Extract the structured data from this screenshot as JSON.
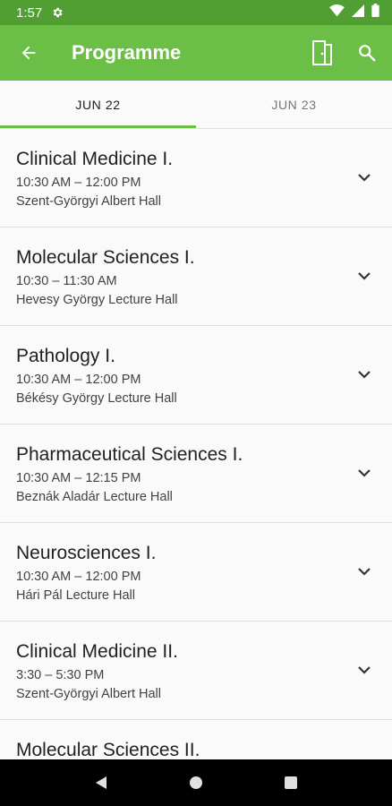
{
  "status_bar": {
    "time": "1:57"
  },
  "app_bar": {
    "title": "Programme"
  },
  "tabs": [
    {
      "label": "JUN 22",
      "active": true
    },
    {
      "label": "JUN 23",
      "active": false
    }
  ],
  "sessions": [
    {
      "title": "Clinical Medicine I.",
      "time": "10:30 AM – 12:00 PM",
      "room": "Szent-Györgyi Albert Hall"
    },
    {
      "title": "Molecular Sciences I.",
      "time": "10:30 – 11:30 AM",
      "room": "Hevesy György Lecture Hall"
    },
    {
      "title": "Pathology I.",
      "time": "10:30 AM – 12:00 PM",
      "room": "Békésy György Lecture Hall"
    },
    {
      "title": "Pharmaceutical Sciences I.",
      "time": "10:30 AM – 12:15 PM",
      "room": "Beznák Aladár Lecture Hall"
    },
    {
      "title": "Neurosciences I.",
      "time": "10:30 AM – 12:00 PM",
      "room": "Hári Pál Lecture Hall"
    },
    {
      "title": "Clinical Medicine II.",
      "time": "3:30 – 5:30 PM",
      "room": "Szent-Györgyi Albert Hall"
    },
    {
      "title": "Molecular Sciences II.",
      "time": "",
      "room": ""
    }
  ],
  "colors": {
    "primary": "#6cbf46",
    "primary_dark": "#519e33"
  }
}
